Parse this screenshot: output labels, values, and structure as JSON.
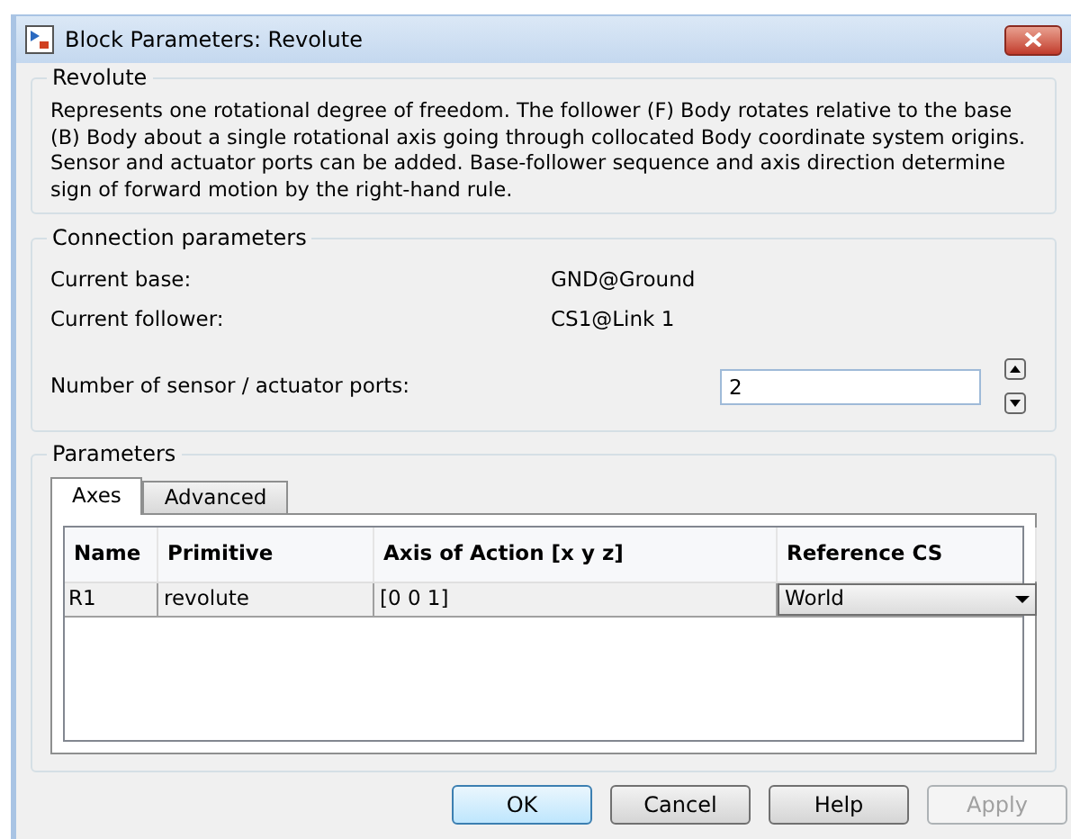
{
  "window": {
    "title": "Block Parameters: Revolute"
  },
  "description": {
    "title": "Revolute",
    "text": "Represents one rotational degree of freedom. The follower (F) Body rotates relative to the base (B) Body about a single rotational axis going through collocated Body coordinate system origins. Sensor and actuator ports can be added. Base-follower sequence and axis direction determine sign of forward motion by the right-hand rule."
  },
  "connection": {
    "title": "Connection parameters",
    "rows": [
      {
        "label": "Current base:",
        "value": "GND@Ground"
      },
      {
        "label": "Current follower:",
        "value": "CS1@Link 1"
      }
    ],
    "ports": {
      "label": "Number of sensor / actuator ports:",
      "value": "2"
    }
  },
  "parameters": {
    "title": "Parameters",
    "tabs": [
      {
        "label": "Axes",
        "selected": true
      },
      {
        "label": "Advanced",
        "selected": false
      }
    ],
    "table": {
      "columns": [
        "Name",
        "Primitive",
        "Axis of Action [x y z]",
        "Reference CS"
      ],
      "rows": [
        {
          "name": "R1",
          "primitive": "revolute",
          "axis": "[0 0 1]",
          "reference": "World"
        }
      ]
    }
  },
  "buttons": [
    {
      "label": "OK",
      "disabled": false,
      "default": true
    },
    {
      "label": "Cancel",
      "disabled": false,
      "default": false
    },
    {
      "label": "Help",
      "disabled": false,
      "default": false
    },
    {
      "label": "Apply",
      "disabled": true,
      "default": false
    }
  ]
}
